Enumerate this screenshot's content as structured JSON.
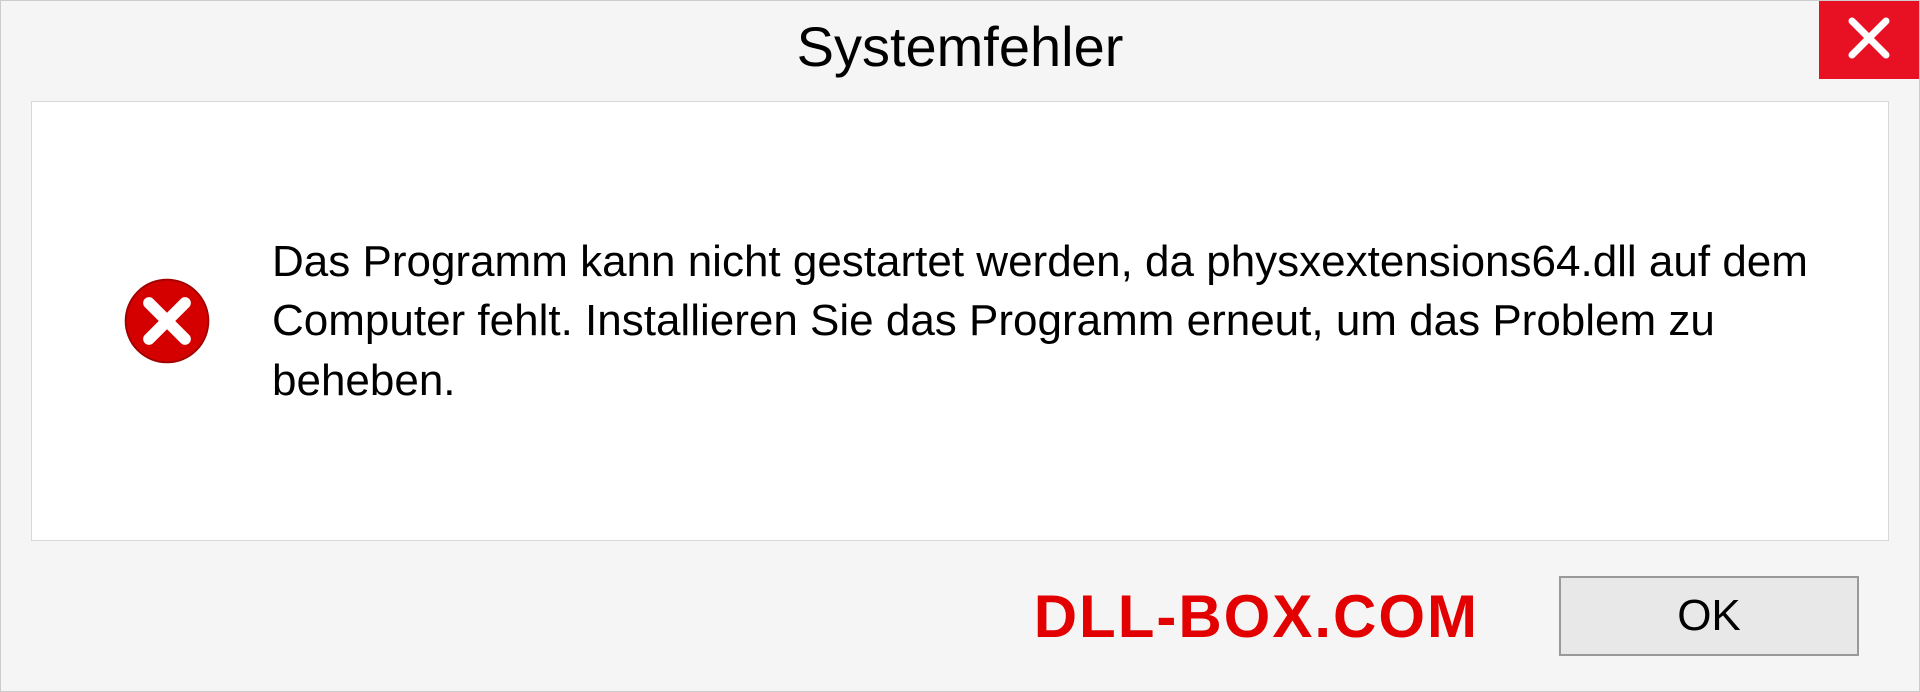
{
  "dialog": {
    "title": "Systemfehler",
    "message": "Das Programm kann nicht gestartet werden, da physxextensions64.dll auf dem Computer fehlt. Installieren Sie das Programm erneut, um das Problem zu beheben.",
    "ok_label": "OK"
  },
  "watermark": "DLL-BOX.COM",
  "colors": {
    "close_bg": "#e81123",
    "error_icon": "#d40000",
    "watermark": "#e20000"
  }
}
